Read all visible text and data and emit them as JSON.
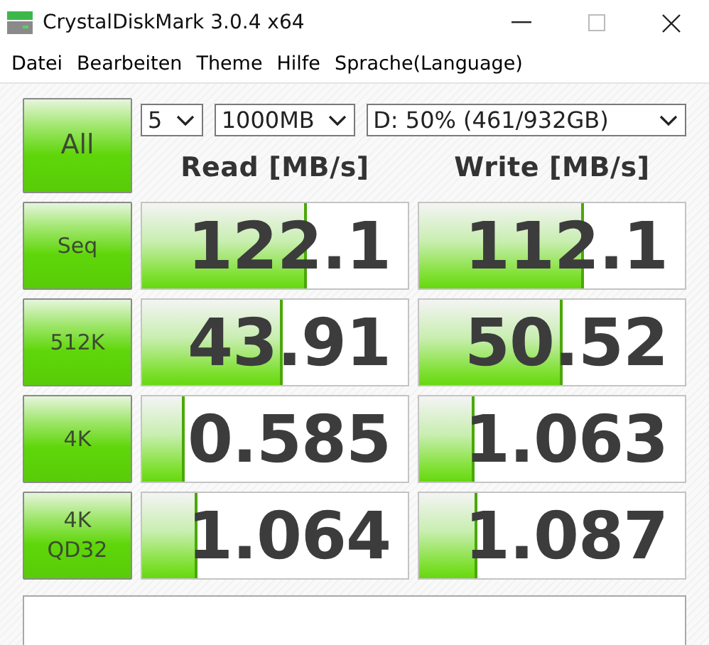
{
  "window": {
    "title": "CrystalDiskMark 3.0.4 x64"
  },
  "menu": [
    "Datei",
    "Bearbeiten",
    "Theme",
    "Hilfe",
    "Sprache(Language)"
  ],
  "toolbar": {
    "all_button": "All",
    "count": "5",
    "size": "1000MB",
    "drive": "D: 50% (461/932GB)"
  },
  "columns": [
    "Read [MB/s]",
    "Write [MB/s]"
  ],
  "rows": [
    {
      "test": "Seq",
      "read": {
        "value": "122.1",
        "level": 0.61
      },
      "write": {
        "value": "112.1",
        "level": 0.61
      }
    },
    {
      "test": "512K",
      "read": {
        "value": "43.91",
        "level": 0.52
      },
      "write": {
        "value": "50.52",
        "level": 0.53
      }
    },
    {
      "test": "4K",
      "read": {
        "value": "0.585",
        "level": 0.15
      },
      "write": {
        "value": "1.063",
        "level": 0.2
      }
    },
    {
      "test": "4K QD32",
      "read": {
        "value": "1.064",
        "level": 0.2
      },
      "write": {
        "value": "1.087",
        "level": 0.21
      }
    }
  ]
}
